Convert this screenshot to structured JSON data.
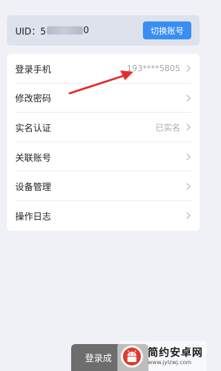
{
  "uid_card": {
    "label_prefix": "UID：5",
    "label_suffix": "0",
    "switch_label": "切换账号"
  },
  "menu": {
    "items": [
      {
        "label": "登录手机",
        "value": "193****5805"
      },
      {
        "label": "修改密码",
        "value": ""
      },
      {
        "label": "实名认证",
        "value": "已实名"
      },
      {
        "label": "关联账号",
        "value": ""
      },
      {
        "label": "设备管理",
        "value": ""
      },
      {
        "label": "操作日志",
        "value": ""
      }
    ]
  },
  "toast": {
    "text": "登录成"
  },
  "watermark": {
    "title": "简约安卓网",
    "url": "www.jylzwj.com"
  },
  "colors": {
    "accent": "#3a8ef2",
    "annotation_arrow": "#e62c2c",
    "page_bg": "#eff1f6"
  },
  "icons": {
    "row_chevron": "chevron-right-icon",
    "annotation": "red-arrow-annotation",
    "logo": "android-logo-icon"
  }
}
